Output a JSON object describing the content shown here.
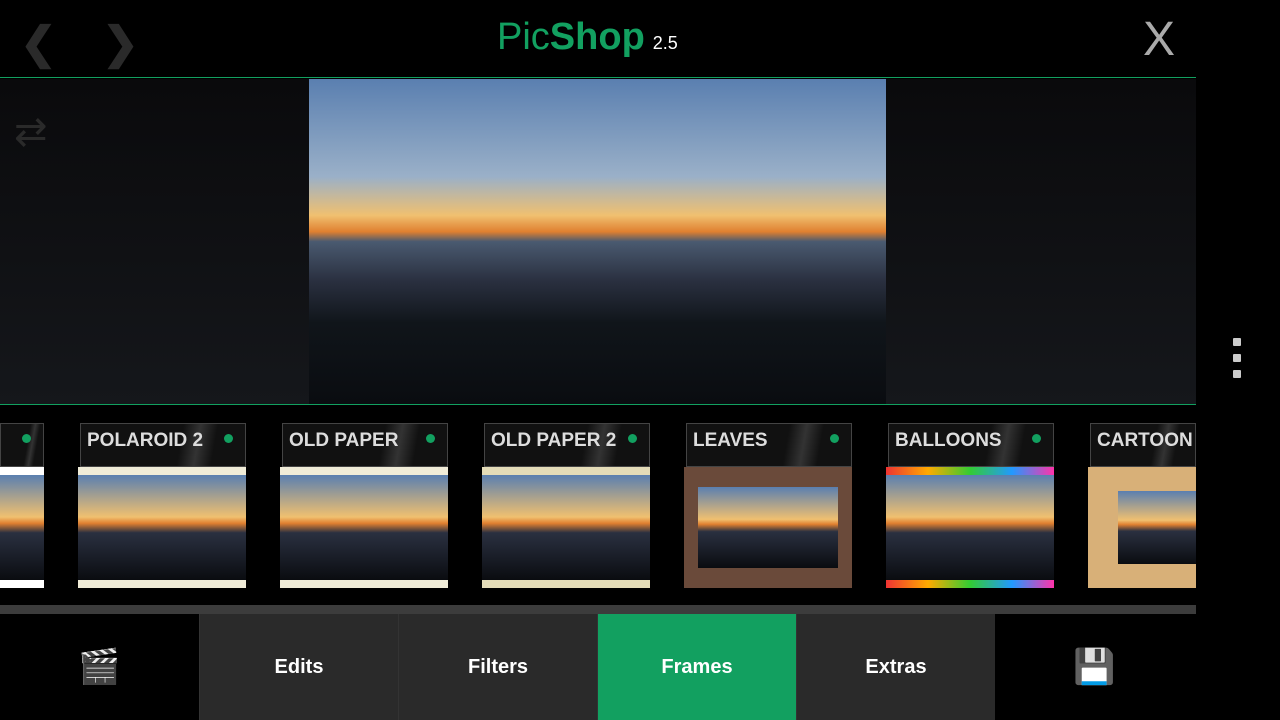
{
  "header": {
    "title_light": "Pic",
    "title_bold": "Shop",
    "version": "2.5",
    "back_icon": "chevron-left",
    "forward_icon": "chevron-right",
    "close_label": "X"
  },
  "stage": {
    "swap_icon": "swap-arrows"
  },
  "frames": [
    {
      "label": ""
    },
    {
      "label": "POLAROID 2"
    },
    {
      "label": "OLD PAPER"
    },
    {
      "label": "OLD PAPER 2"
    },
    {
      "label": "LEAVES"
    },
    {
      "label": "BALLOONS"
    },
    {
      "label": "CARTOON"
    }
  ],
  "tabs": [
    {
      "label": "Edits"
    },
    {
      "label": "Filters"
    },
    {
      "label": "Frames",
      "active": true
    },
    {
      "label": "Extras"
    }
  ],
  "colors": {
    "accent": "#12a060",
    "tab_bg": "#2a2a2a"
  }
}
